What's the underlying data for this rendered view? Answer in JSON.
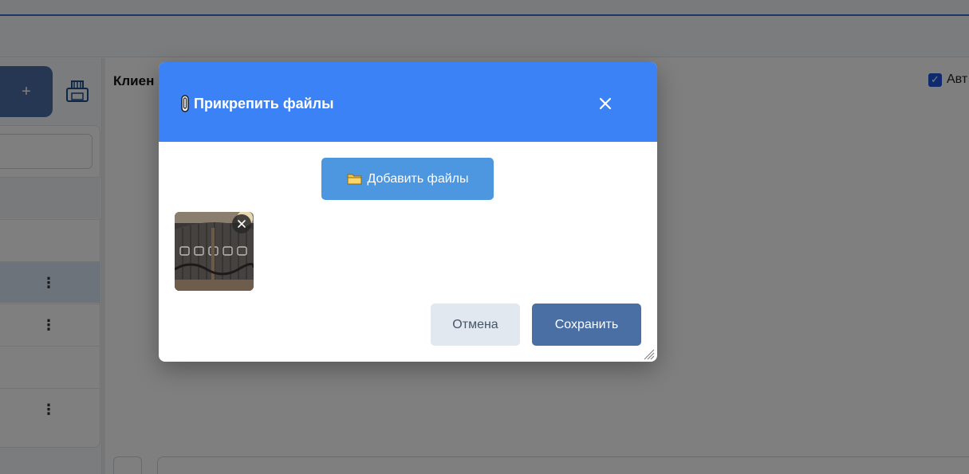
{
  "background": {
    "add_button_label": "+",
    "main_title": "Клиен",
    "auto_checkbox_label": "Авт",
    "kebab_label": "⋮"
  },
  "modal": {
    "title": "Прикрепить файлы",
    "title_icon": "paperclip-icon",
    "close_icon": "close-icon",
    "add_files_label": "Добавить файлы",
    "add_files_icon": "folder-icon",
    "attachments": [
      {
        "type": "image",
        "description_icon": "image-thumbnail"
      }
    ],
    "cancel_label": "Отмена",
    "save_label": "Сохранить"
  },
  "colors": {
    "header": "#3b82f6",
    "add_files_button": "#4d96e0",
    "save_button": "#4a6fa5",
    "cancel_button": "#e2e8f0"
  }
}
